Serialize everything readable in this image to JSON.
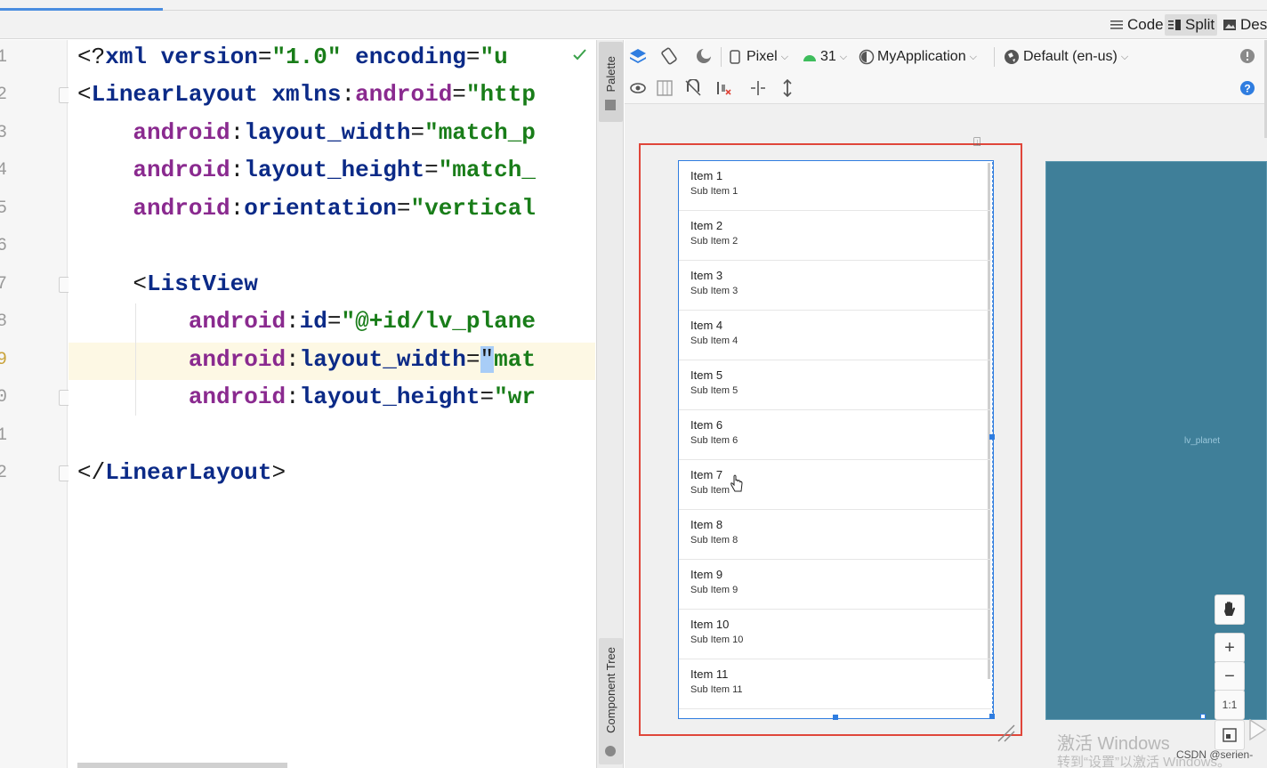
{
  "view_modes": {
    "code": "Code",
    "split": "Split",
    "design": "Desi"
  },
  "editor": {
    "line_numbers": [
      "1",
      "2",
      "3",
      "4",
      "5",
      "6",
      "7",
      "8",
      "9",
      "0",
      "1",
      "2"
    ],
    "lines": [
      [
        {
          "c": "punc",
          "t": "<?"
        },
        {
          "c": "tag",
          "t": "xml"
        },
        {
          "c": "punc",
          "t": " "
        },
        {
          "c": "attr",
          "t": "version"
        },
        {
          "c": "punc",
          "t": "="
        },
        {
          "c": "val",
          "t": "\"1.0\""
        },
        {
          "c": "punc",
          "t": " "
        },
        {
          "c": "attr",
          "t": "encoding"
        },
        {
          "c": "punc",
          "t": "="
        },
        {
          "c": "val",
          "t": "\"u"
        }
      ],
      [
        {
          "c": "punc",
          "t": "<"
        },
        {
          "c": "tag",
          "t": "LinearLayout"
        },
        {
          "c": "punc",
          "t": " "
        },
        {
          "c": "attr",
          "t": "xmlns"
        },
        {
          "c": "punc",
          "t": ":"
        },
        {
          "c": "ns",
          "t": "android"
        },
        {
          "c": "punc",
          "t": "="
        },
        {
          "c": "val",
          "t": "\"http"
        }
      ],
      [
        {
          "c": "punc",
          "t": "    "
        },
        {
          "c": "ns",
          "t": "android"
        },
        {
          "c": "punc",
          "t": ":"
        },
        {
          "c": "attr",
          "t": "layout_width"
        },
        {
          "c": "punc",
          "t": "="
        },
        {
          "c": "val",
          "t": "\"match_p"
        }
      ],
      [
        {
          "c": "punc",
          "t": "    "
        },
        {
          "c": "ns",
          "t": "android"
        },
        {
          "c": "punc",
          "t": ":"
        },
        {
          "c": "attr",
          "t": "layout_height"
        },
        {
          "c": "punc",
          "t": "="
        },
        {
          "c": "val",
          "t": "\"match_"
        }
      ],
      [
        {
          "c": "punc",
          "t": "    "
        },
        {
          "c": "ns",
          "t": "android"
        },
        {
          "c": "punc",
          "t": ":"
        },
        {
          "c": "attr",
          "t": "orientation"
        },
        {
          "c": "punc",
          "t": "="
        },
        {
          "c": "val",
          "t": "\"vertical"
        }
      ],
      [],
      [
        {
          "c": "punc",
          "t": "    <"
        },
        {
          "c": "tag",
          "t": "ListView"
        }
      ],
      [
        {
          "c": "punc",
          "t": "        "
        },
        {
          "c": "ns",
          "t": "android"
        },
        {
          "c": "punc",
          "t": ":"
        },
        {
          "c": "attr",
          "t": "id"
        },
        {
          "c": "punc",
          "t": "="
        },
        {
          "c": "val",
          "t": "\"@+id/lv_plane"
        }
      ],
      [
        {
          "c": "punc",
          "t": "        "
        },
        {
          "c": "ns",
          "t": "android"
        },
        {
          "c": "punc",
          "t": ":"
        },
        {
          "c": "attr",
          "t": "layout_width"
        },
        {
          "c": "punc",
          "t": "="
        },
        {
          "c": "caret",
          "t": "\""
        },
        {
          "c": "val",
          "t": "mat"
        }
      ],
      [
        {
          "c": "punc",
          "t": "        "
        },
        {
          "c": "ns",
          "t": "android"
        },
        {
          "c": "punc",
          "t": ":"
        },
        {
          "c": "attr",
          "t": "layout_height"
        },
        {
          "c": "punc",
          "t": "="
        },
        {
          "c": "val",
          "t": "\"wr"
        }
      ],
      [],
      [
        {
          "c": "punc",
          "t": "</"
        },
        {
          "c": "tag",
          "t": "LinearLayout"
        },
        {
          "c": "punc",
          "t": ">"
        }
      ]
    ]
  },
  "side_strip": {
    "palette": "Palette",
    "component_tree": "Component Tree"
  },
  "design_toolbar": {
    "device": "Pixel",
    "api": "31",
    "app": "MyApplication",
    "locale": "Default (en-us)"
  },
  "preview": {
    "items": [
      {
        "title": "Item 1",
        "sub": "Sub Item 1"
      },
      {
        "title": "Item 2",
        "sub": "Sub Item 2"
      },
      {
        "title": "Item 3",
        "sub": "Sub Item 3"
      },
      {
        "title": "Item 4",
        "sub": "Sub Item 4"
      },
      {
        "title": "Item 5",
        "sub": "Sub Item 5"
      },
      {
        "title": "Item 6",
        "sub": "Sub Item 6"
      },
      {
        "title": "Item 7",
        "sub": "Sub Item"
      },
      {
        "title": "Item 8",
        "sub": "Sub Item 8"
      },
      {
        "title": "Item 9",
        "sub": "Sub Item 9"
      },
      {
        "title": "Item 10",
        "sub": "Sub Item 10"
      },
      {
        "title": "Item 11",
        "sub": "Sub Item 11"
      }
    ],
    "blueprint_label": "lv_planet"
  },
  "zoom": {
    "zoom_in": "+",
    "zoom_out": "−",
    "actual_size": "1:1"
  },
  "watermark": {
    "line1": "激活 Windows",
    "line2": "转到“设置”以激活 Windows。"
  },
  "credit": "CSDN @serien-",
  "colors": {
    "selection": "#e0463a",
    "blueprint": "#3f7f99",
    "accent": "#2f7de0"
  }
}
